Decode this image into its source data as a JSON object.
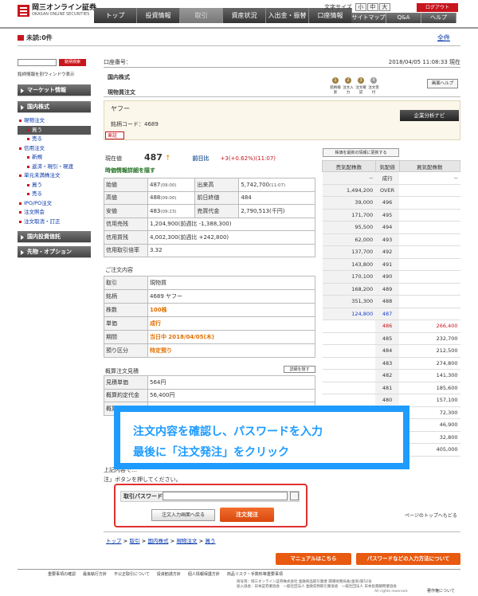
{
  "header": {
    "logo_jp": "岡三オンライン証券",
    "logo_en": "OKASAN ONLINE SECURITIES",
    "tabs": [
      "トップ",
      "投資情報",
      "取引",
      "資産状況",
      "入出金・振替",
      "口座情報"
    ],
    "font_size_label": "文字サイズ",
    "font_sizes": [
      "小",
      "中",
      "大"
    ],
    "logout": "ログアウト",
    "subnav": [
      "サイトマップ",
      "Q&A",
      "ヘルプ"
    ]
  },
  "notice": {
    "unread": "未読:0件",
    "all": "全件"
  },
  "sidebar": {
    "symbol_search": "銘柄検索",
    "open_window": "銘柄情報を別ウィンドウ表示",
    "sections": [
      {
        "label": "マーケット情報"
      },
      {
        "label": "国内株式"
      },
      {
        "label": "国内投資信託"
      },
      {
        "label": "先物・オプション"
      }
    ],
    "items": [
      {
        "label": "現物注文",
        "sub": false,
        "sel": false
      },
      {
        "label": "買う",
        "sub": true,
        "sel": true
      },
      {
        "label": "売る",
        "sub": true,
        "sel": false
      },
      {
        "label": "信用注文",
        "sub": false,
        "sel": false
      },
      {
        "label": "新規",
        "sub": true,
        "sel": false
      },
      {
        "label": "返済・現引・現渡",
        "sub": true,
        "sel": false
      },
      {
        "label": "単元未満株注文",
        "sub": false,
        "sel": false
      },
      {
        "label": "買う",
        "sub": true,
        "sel": false
      },
      {
        "label": "売る",
        "sub": true,
        "sel": false
      },
      {
        "label": "IPO/PO注文",
        "sub": false,
        "sel": false
      },
      {
        "label": "注文照会",
        "sub": false,
        "sel": false
      },
      {
        "label": "注文取消・訂正",
        "sub": false,
        "sel": false
      }
    ]
  },
  "account": {
    "label": "口座番号：",
    "datetime": "2018/04/05 11:08:33 現在"
  },
  "breadcrumb": {
    "l1": "国内株式",
    "l2": "現物買注文"
  },
  "steps": [
    {
      "n": "1",
      "label": "銘柄検索"
    },
    {
      "n": "2",
      "label": "注文入力"
    },
    {
      "n": "3",
      "label": "注文確認"
    },
    {
      "n": "4",
      "label": "注文受付"
    }
  ],
  "screen_help": "画面ヘルプ",
  "stock": {
    "name": "ヤフー",
    "code": "銘柄コード：4689",
    "market": "東証",
    "navi": "企業分析ナビ"
  },
  "price": {
    "label": "現在値",
    "value": "487",
    "arrow": "↑",
    "change_label": "前日比",
    "change": "+3(+0.62%)(11:07)"
  },
  "detail_toggle": "時価情報詳細を隠す",
  "quote_rows": [
    [
      "始値",
      "487",
      "(09:00)",
      "出来高",
      "5,742,700",
      "(11:07)"
    ],
    [
      "高値",
      "488",
      "(09:00)",
      "前日終値",
      "484",
      ""
    ],
    [
      "安値",
      "483",
      "(09:23)",
      "売買代金",
      "2,790,513(千円)",
      ""
    ]
  ],
  "credit_rows": [
    [
      "信用売残",
      "1,204,900(前週比 -1,388,300)"
    ],
    [
      "信用買残",
      "4,002,300(前週比 +242,800)"
    ],
    [
      "信用取引倍率",
      "3.32"
    ]
  ],
  "order_title": "ご注文内容",
  "order_rows": [
    [
      "取引",
      "現物買"
    ],
    [
      "銘柄",
      "4689 ヤフー"
    ],
    [
      "株数",
      "100株"
    ],
    [
      "単価",
      "成行"
    ],
    [
      "期間",
      "当日中 2018/04/05(木)"
    ],
    [
      "預り区分",
      "特定預り"
    ]
  ],
  "estimate_title": "概算注文見積",
  "estimate_toggle": "詳細を隠す",
  "estimate_rows": [
    [
      "見積単価",
      "564円"
    ],
    [
      "概算約定代金",
      "56,400円"
    ],
    [
      "概算手数料/区分",
      "350円/定額プラン"
    ]
  ],
  "board": {
    "refresh": "株価を最新の情報に更新する",
    "headers": [
      "売気配株数",
      "気配値",
      "買気配株数"
    ],
    "rows": [
      [
        "--",
        "成行",
        "--"
      ],
      [
        "1,494,200",
        "OVER",
        ""
      ],
      [
        "39,000",
        "496",
        ""
      ],
      [
        "171,700",
        "495",
        ""
      ],
      [
        "95,500",
        "494",
        ""
      ],
      [
        "62,000",
        "493",
        ""
      ],
      [
        "137,700",
        "492",
        ""
      ],
      [
        "143,800",
        "491",
        ""
      ],
      [
        "170,100",
        "490",
        ""
      ],
      [
        "168,200",
        "489",
        ""
      ],
      [
        "351,300",
        "488",
        ""
      ],
      [
        "124,800",
        "487",
        ""
      ],
      [
        "",
        "486",
        "266,400"
      ],
      [
        "",
        "485",
        "232,700"
      ],
      [
        "",
        "484",
        "212,500"
      ],
      [
        "",
        "483",
        "274,800"
      ],
      [
        "",
        "482",
        "141,300"
      ],
      [
        "",
        "481",
        "185,600"
      ],
      [
        "",
        "480",
        "157,100"
      ],
      [
        "",
        "479",
        "72,300"
      ],
      [
        "",
        "478",
        "46,900"
      ],
      [
        "",
        "477",
        "32,800"
      ],
      [
        "",
        "UNDER",
        "405,000"
      ]
    ]
  },
  "callout": {
    "line1": "注文内容を確認し、パスワードを入力",
    "line2": "最後に「注文発注」をクリック"
  },
  "instructions": {
    "line1": "上記内容で…",
    "line2": "注」ボタンを押してください。"
  },
  "password": {
    "label": "取引パスワード："
  },
  "buttons": {
    "back": "注文入力画面へ戻る",
    "submit": "注文発注"
  },
  "page_top": "ページのトップへもどる",
  "crumbs": [
    "トップ",
    "取引",
    "国内株式",
    "現物注文",
    "買う"
  ],
  "bottom_buttons": {
    "manual": "マニュアルはこちら",
    "pw_method": "パスワードなどの入力方法について"
  },
  "footer_links": [
    "重要事項の確認",
    "最良執行方針",
    "不公正取引について",
    "投資勧誘方針",
    "個人情報保護方針",
    "商品リスク・手数料等重要事項"
  ],
  "footer_info": {
    "l1": "商号等：岡三オンライン証券株式会社 金融商品取引業者 関東財務局長(金商)第52号",
    "l2": "加入協会：日本証券業協会　一般社団法人 金融先物取引業協会　一般社団法人 日本投資顧問業協会"
  },
  "copyright": "All rights reserved.",
  "disclaimer": "著作権について"
}
